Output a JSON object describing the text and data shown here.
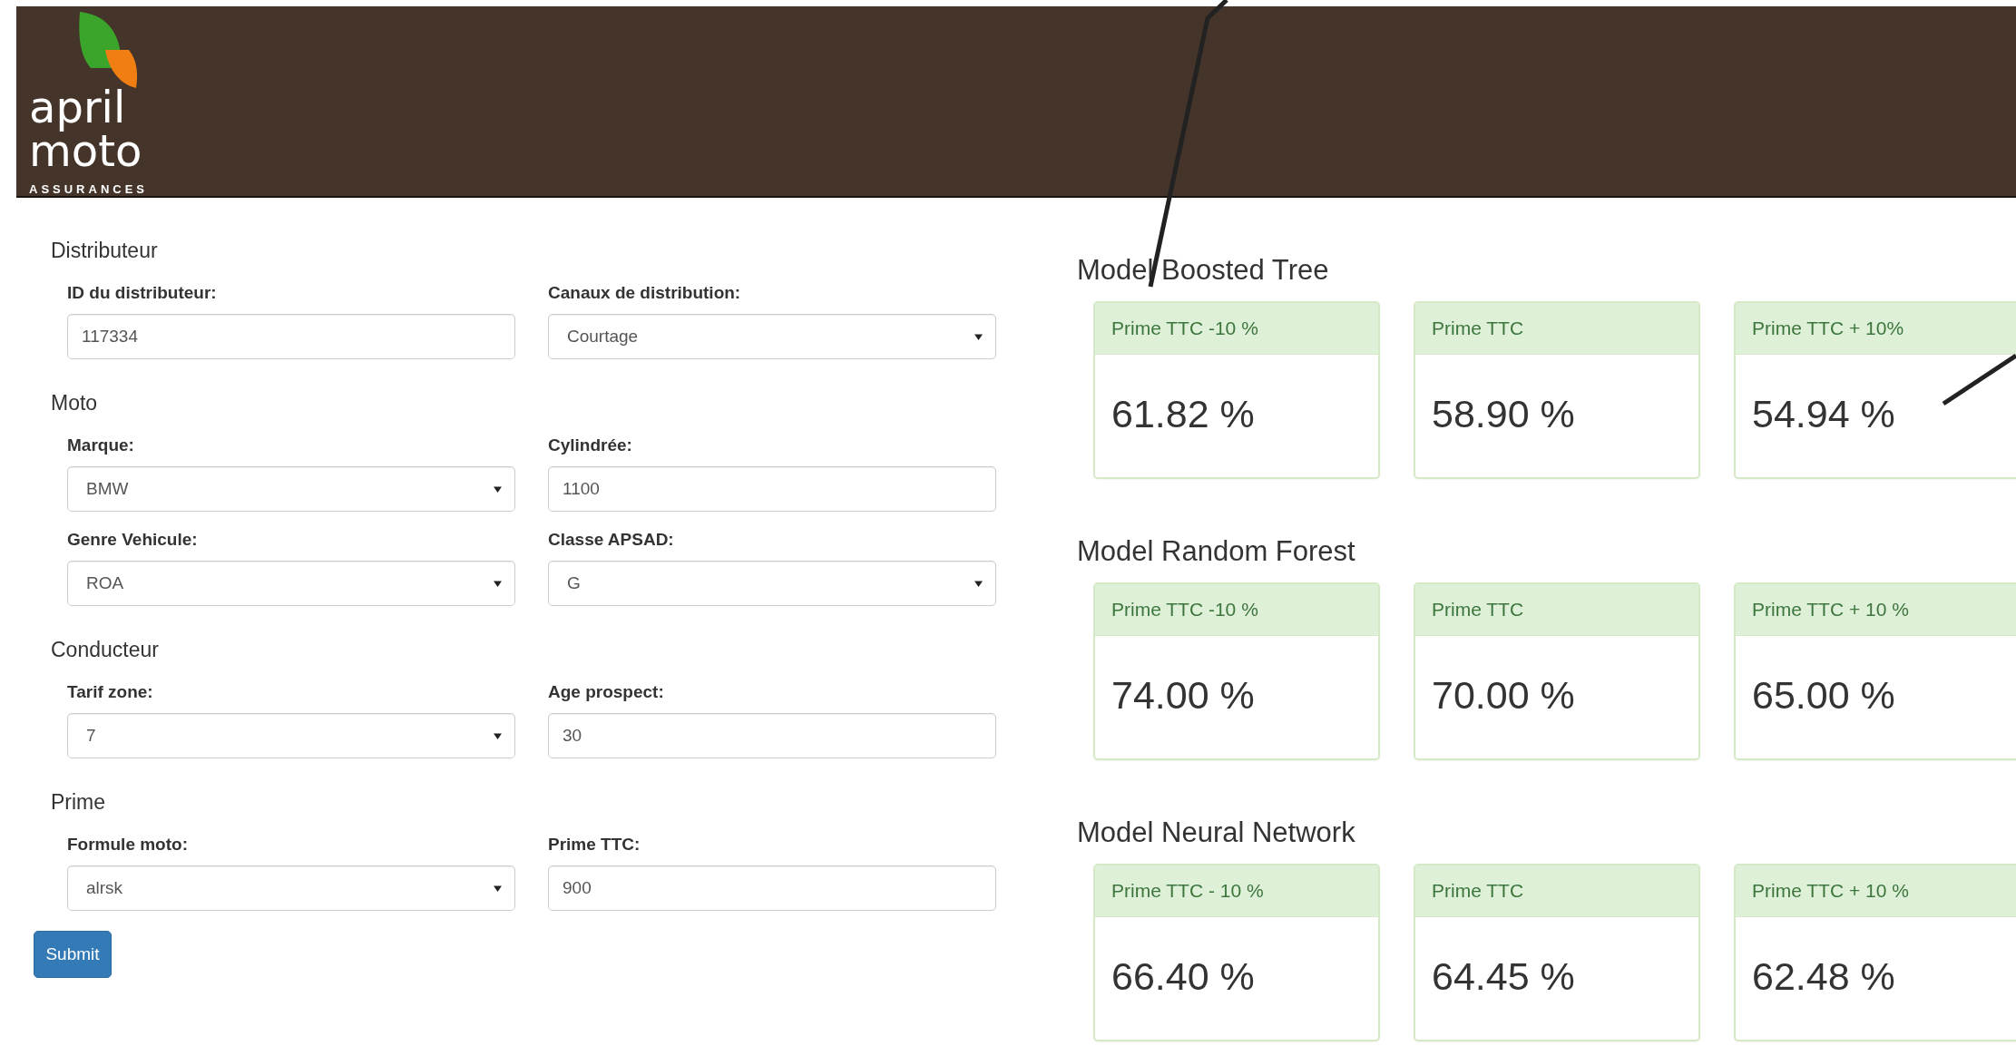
{
  "logo": {
    "line1": "april",
    "line2": "moto",
    "tagline": "ASSURANCES"
  },
  "form": {
    "sections": [
      {
        "title": "Distributeur",
        "fields": [
          {
            "label": "ID du distributeur:",
            "kind": "input",
            "value": "117334"
          },
          {
            "label": "Canaux de distribution:",
            "kind": "select",
            "value": "Courtage"
          }
        ]
      },
      {
        "title": "Moto",
        "fields": [
          {
            "label": "Marque:",
            "kind": "select",
            "value": "BMW"
          },
          {
            "label": "Cylindrée:",
            "kind": "input",
            "value": "1100"
          },
          {
            "label": "Genre Vehicule:",
            "kind": "select",
            "value": "ROA"
          },
          {
            "label": "Classe APSAD:",
            "kind": "select",
            "value": "G"
          }
        ]
      },
      {
        "title": "Conducteur",
        "fields": [
          {
            "label": "Tarif zone:",
            "kind": "select",
            "value": "7"
          },
          {
            "label": "Age prospect:",
            "kind": "input",
            "value": "30"
          }
        ]
      },
      {
        "title": "Prime",
        "fields": [
          {
            "label": "Formule moto:",
            "kind": "select",
            "value": "alrsk"
          },
          {
            "label": "Prime TTC:",
            "kind": "input",
            "value": "900"
          }
        ]
      }
    ],
    "submit": "Submit"
  },
  "models": [
    {
      "title": "Model Boosted Tree",
      "cards": [
        {
          "label": "Prime TTC -10 %",
          "value": "61.82 %"
        },
        {
          "label": "Prime TTC",
          "value": "58.90 %"
        },
        {
          "label": "Prime TTC + 10%",
          "value": "54.94 %"
        }
      ]
    },
    {
      "title": "Model Random Forest",
      "cards": [
        {
          "label": "Prime TTC -10 %",
          "value": "74.00 %"
        },
        {
          "label": "Prime TTC",
          "value": "70.00 %"
        },
        {
          "label": "Prime TTC + 10 %",
          "value": "65.00 %"
        }
      ]
    },
    {
      "title": "Model Neural Network",
      "cards": [
        {
          "label": "Prime TTC - 10 %",
          "value": "66.40 %"
        },
        {
          "label": "Prime TTC",
          "value": "64.45 %"
        },
        {
          "label": "Prime TTC + 10 %",
          "value": "62.48 %"
        }
      ]
    }
  ]
}
